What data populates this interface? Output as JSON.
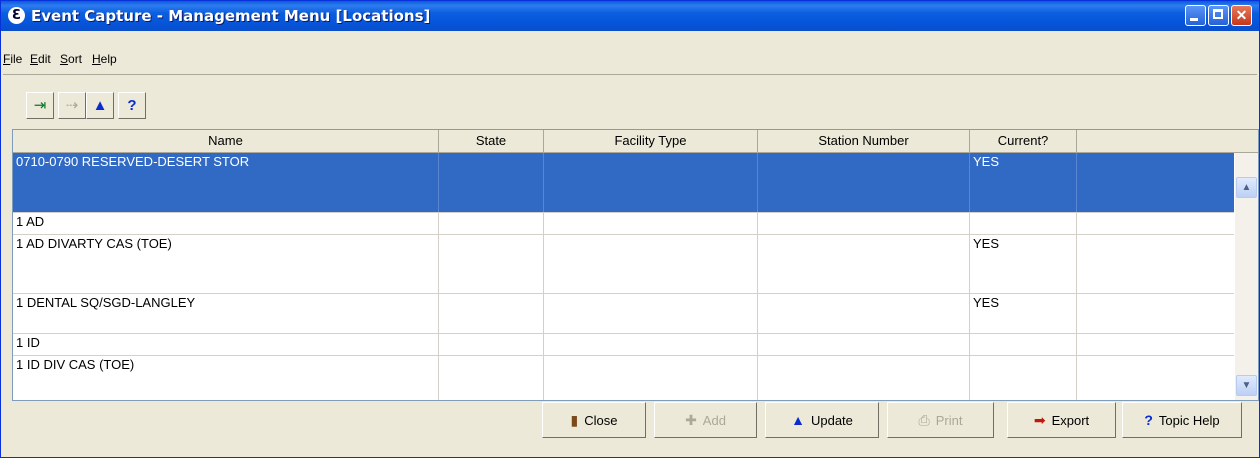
{
  "window": {
    "title": "Event Capture - Management Menu [Locations]",
    "app_icon": "Ɛ"
  },
  "menu": [
    {
      "label": "File"
    },
    {
      "label": "Edit"
    },
    {
      "label": "Sort"
    },
    {
      "label": "Help"
    }
  ],
  "toolbar": {
    "exit_icon": "⇥",
    "add_icon": "⇢",
    "update_icon": "▲",
    "help_icon": "?"
  },
  "columns": [
    "Name",
    "State",
    "Facility Type",
    "Station Number",
    "Current?"
  ],
  "rows": [
    {
      "name": "0710-0790 RESERVED-DESERT STOR",
      "state": "",
      "facility_type": "",
      "station_number": "",
      "current": "YES",
      "selected": true
    },
    {
      "name": "1 AD",
      "state": "",
      "facility_type": "",
      "station_number": "",
      "current": ""
    },
    {
      "name": "1 AD DIVARTY CAS (TOE)",
      "state": "",
      "facility_type": "",
      "station_number": "",
      "current": "YES"
    },
    {
      "name": "1 DENTAL SQ/SGD-LANGLEY",
      "state": "",
      "facility_type": "",
      "station_number": "",
      "current": "YES"
    },
    {
      "name": "1 ID",
      "state": "",
      "facility_type": "",
      "station_number": "",
      "current": ""
    },
    {
      "name": "1 ID DIV CAS (TOE)",
      "state": "",
      "facility_type": "",
      "station_number": "",
      "current": ""
    }
  ],
  "buttons": {
    "close": "Close",
    "add": "Add",
    "update": "Update",
    "print": "Print",
    "export": "Export",
    "topic_help": "Topic Help"
  },
  "colors": {
    "selection": "#316ac5",
    "titlebar": "#0653d8"
  }
}
